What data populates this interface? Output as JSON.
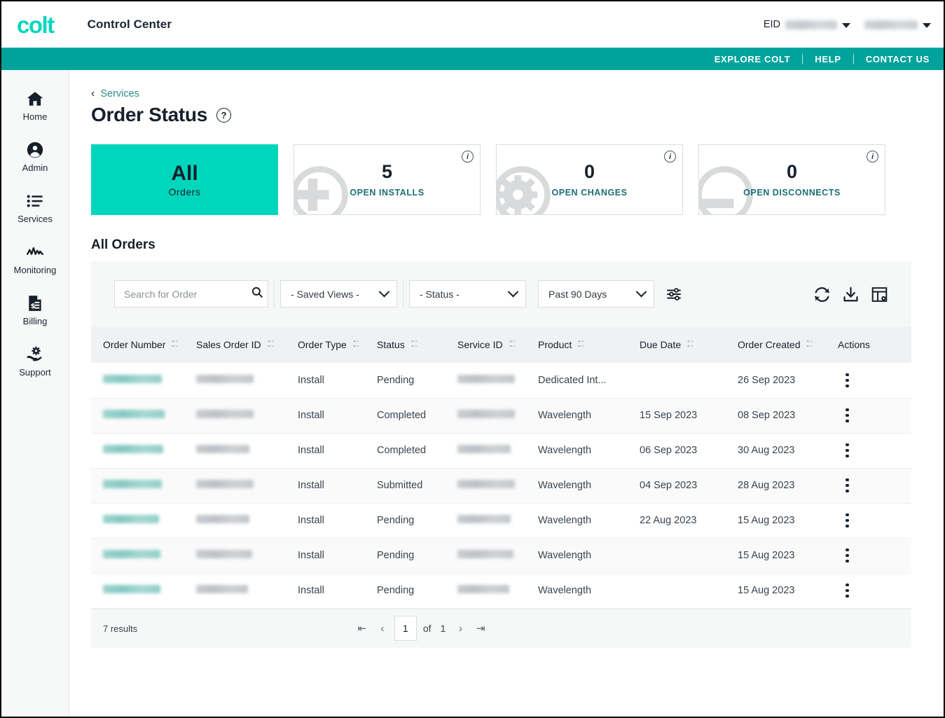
{
  "header": {
    "logo": "colt",
    "app_title": "Control Center",
    "eid_label": "EID",
    "eid_value": "",
    "user_name": "",
    "brand_teal": "#00D6BC",
    "nav_teal": "#00A39B"
  },
  "utility_nav": {
    "items": [
      {
        "label": "EXPLORE COLT"
      },
      {
        "label": "HELP"
      },
      {
        "label": "CONTACT US"
      }
    ]
  },
  "sidebar": {
    "items": [
      {
        "label": "Home",
        "icon": "home-icon"
      },
      {
        "label": "Admin",
        "icon": "user-circle-icon"
      },
      {
        "label": "Services",
        "icon": "list-icon"
      },
      {
        "label": "Monitoring",
        "icon": "activity-icon"
      },
      {
        "label": "Billing",
        "icon": "invoice-icon"
      },
      {
        "label": "Support",
        "icon": "support-hand-icon"
      }
    ]
  },
  "page": {
    "breadcrumb": "Services",
    "title": "Order Status",
    "help_glyph": "?"
  },
  "cards": [
    {
      "value": "All",
      "label": "Orders",
      "active": true,
      "icon": "none",
      "info": false
    },
    {
      "value": "5",
      "label": "OPEN INSTALLS",
      "active": false,
      "icon": "plus-circle-icon",
      "info": true
    },
    {
      "value": "0",
      "label": "OPEN CHANGES",
      "active": false,
      "icon": "gear-circle-icon",
      "info": true
    },
    {
      "value": "0",
      "label": "OPEN DISCONNECTS",
      "active": false,
      "icon": "minus-circle-icon",
      "info": true
    }
  ],
  "section": {
    "title": "All Orders"
  },
  "toolbar": {
    "search_placeholder": "Search for Order",
    "search_value": "",
    "saved_views": "- Saved Views -",
    "status_filter": "- Status -",
    "date_range": "Past 90 Days",
    "icons": [
      {
        "name": "filter-sliders-icon"
      },
      {
        "name": "refresh-icon"
      },
      {
        "name": "download-icon"
      },
      {
        "name": "table-settings-icon"
      }
    ]
  },
  "table": {
    "columns": [
      {
        "label": "Order Number",
        "sortable": true
      },
      {
        "label": "Sales Order ID",
        "sortable": true
      },
      {
        "label": "Order Type",
        "sortable": true
      },
      {
        "label": "Status",
        "sortable": true
      },
      {
        "label": "Service ID",
        "sortable": true
      },
      {
        "label": "Product",
        "sortable": true
      },
      {
        "label": "Due Date",
        "sortable": true
      },
      {
        "label": "Order Created",
        "sortable": true
      },
      {
        "label": "Actions",
        "sortable": false
      }
    ],
    "rows": [
      {
        "order_number": "",
        "sales_order_id": "",
        "order_type": "Install",
        "status": "Pending",
        "service_id": "",
        "product": "Dedicated Int...",
        "due_date": "",
        "order_created": "26 Sep 2023"
      },
      {
        "order_number": "",
        "sales_order_id": "",
        "order_type": "Install",
        "status": "Completed",
        "service_id": "",
        "product": "Wavelength",
        "due_date": "15 Sep 2023",
        "order_created": "08 Sep 2023"
      },
      {
        "order_number": "",
        "sales_order_id": "",
        "order_type": "Install",
        "status": "Completed",
        "service_id": "",
        "product": "Wavelength",
        "due_date": "06 Sep 2023",
        "order_created": "30 Aug 2023"
      },
      {
        "order_number": "",
        "sales_order_id": "",
        "order_type": "Install",
        "status": "Submitted",
        "service_id": "",
        "product": "Wavelength",
        "due_date": "04 Sep 2023",
        "order_created": "28 Aug 2023"
      },
      {
        "order_number": "",
        "sales_order_id": "",
        "order_type": "Install",
        "status": "Pending",
        "service_id": "",
        "product": "Wavelength",
        "due_date": "22 Aug 2023",
        "order_created": "15 Aug 2023"
      },
      {
        "order_number": "",
        "sales_order_id": "",
        "order_type": "Install",
        "status": "Pending",
        "service_id": "",
        "product": "Wavelength",
        "due_date": "",
        "order_created": "15 Aug 2023"
      },
      {
        "order_number": "",
        "sales_order_id": "",
        "order_type": "Install",
        "status": "Pending",
        "service_id": "",
        "product": "Wavelength",
        "due_date": "",
        "order_created": "15 Aug 2023"
      }
    ]
  },
  "footer": {
    "results": "7 results",
    "page_current": "1",
    "of_label": "of",
    "page_total": "1"
  }
}
